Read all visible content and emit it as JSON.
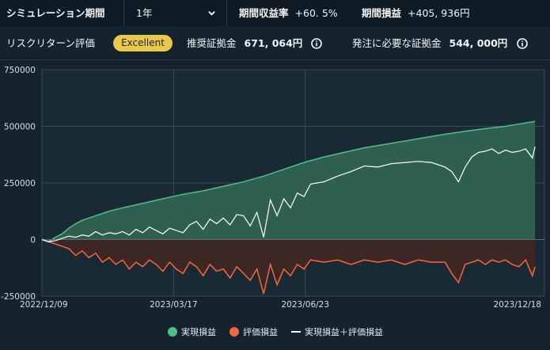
{
  "header": {
    "simulation_label": "シミュレーション期間",
    "period_value": "1年",
    "return_rate_label": "期間収益率",
    "return_rate_value": "+60. 5%",
    "pnl_label": "期間損益",
    "pnl_value": "+405, 936円"
  },
  "evaluation": {
    "label": "リスクリターン評価",
    "badge": "Excellent",
    "recommended_label": "推奨証拠金",
    "recommended_value": "671, 064円",
    "required_label": "発注に必要な証拠金",
    "required_value": "544, 000円"
  },
  "icons": {
    "period_dropdown": "chevron-down-icon",
    "info": "info-icon"
  },
  "colors": {
    "realized": "#4fbf86",
    "realized_fill": "#2f5f50",
    "unrealized": "#f4663d",
    "unrealized_fill": "#3d2724",
    "total": "#ffffff",
    "badge": "#e9c84a",
    "background": "#14232e"
  },
  "chart_data": {
    "type": "area",
    "y_ticks": [
      "750000",
      "500000",
      "250000",
      "0",
      "-250000"
    ],
    "ylim": [
      -250000,
      750000
    ],
    "x_ticks": [
      "2022/12/09",
      "2023/03/17",
      "2023/06/23",
      "2023/12/18"
    ],
    "x_tick_days": [
      0,
      98,
      196,
      374
    ],
    "xlim_days": [
      0,
      374
    ],
    "grid": true,
    "legend_position": "bottom",
    "series": [
      {
        "name": "実現損益",
        "x_days": [
          0,
          5,
          10,
          15,
          20,
          25,
          30,
          40,
          50,
          60,
          75,
          90,
          105,
          120,
          135,
          150,
          165,
          180,
          195,
          210,
          225,
          240,
          255,
          270,
          285,
          300,
          315,
          330,
          345,
          360,
          367
        ],
        "values": [
          0,
          -10000,
          10000,
          25000,
          50000,
          70000,
          85000,
          105000,
          125000,
          140000,
          160000,
          180000,
          200000,
          215000,
          235000,
          255000,
          280000,
          310000,
          340000,
          365000,
          385000,
          405000,
          420000,
          435000,
          450000,
          465000,
          478000,
          490000,
          500000,
          515000,
          522000
        ]
      },
      {
        "name": "評価損益",
        "x_days": [
          0,
          10,
          20,
          25,
          30,
          35,
          40,
          45,
          50,
          55,
          60,
          65,
          70,
          75,
          80,
          85,
          90,
          95,
          100,
          105,
          110,
          115,
          120,
          125,
          130,
          135,
          140,
          145,
          150,
          155,
          160,
          165,
          170,
          175,
          180,
          185,
          190,
          195,
          200,
          210,
          220,
          230,
          240,
          250,
          260,
          270,
          280,
          290,
          300,
          305,
          310,
          315,
          320,
          325,
          330,
          335,
          340,
          345,
          350,
          355,
          360,
          365,
          367
        ],
        "values": [
          0,
          -20000,
          -40000,
          -70000,
          -50000,
          -80000,
          -60000,
          -100000,
          -80000,
          -110000,
          -90000,
          -130000,
          -100000,
          -120000,
          -90000,
          -110000,
          -140000,
          -100000,
          -130000,
          -150000,
          -100000,
          -120000,
          -160000,
          -110000,
          -140000,
          -130000,
          -170000,
          -120000,
          -150000,
          -180000,
          -130000,
          -240000,
          -110000,
          -200000,
          -130000,
          -160000,
          -110000,
          -130000,
          -90000,
          -100000,
          -90000,
          -110000,
          -90000,
          -100000,
          -90000,
          -110000,
          -90000,
          -100000,
          -100000,
          -150000,
          -190000,
          -110000,
          -100000,
          -90000,
          -110000,
          -90000,
          -100000,
          -90000,
          -110000,
          -120000,
          -90000,
          -160000,
          -120000
        ]
      },
      {
        "name": "実現損益＋評価損益",
        "x_days": [
          0,
          5,
          10,
          15,
          20,
          25,
          30,
          35,
          40,
          45,
          50,
          55,
          60,
          65,
          70,
          75,
          80,
          85,
          90,
          95,
          100,
          105,
          110,
          115,
          120,
          125,
          130,
          135,
          140,
          145,
          150,
          155,
          160,
          165,
          170,
          175,
          180,
          185,
          190,
          195,
          200,
          210,
          220,
          230,
          240,
          250,
          260,
          270,
          280,
          290,
          300,
          305,
          310,
          315,
          320,
          325,
          330,
          335,
          340,
          345,
          350,
          355,
          360,
          365,
          367
        ],
        "values": [
          0,
          -10000,
          -5000,
          5000,
          15000,
          10000,
          20000,
          15000,
          35000,
          20000,
          30000,
          25000,
          35000,
          20000,
          45000,
          30000,
          55000,
          40000,
          25000,
          50000,
          40000,
          30000,
          65000,
          80000,
          45000,
          90000,
          70000,
          95000,
          65000,
          110000,
          105000,
          60000,
          120000,
          10000,
          175000,
          105000,
          180000,
          140000,
          205000,
          190000,
          245000,
          255000,
          280000,
          300000,
          325000,
          320000,
          335000,
          340000,
          345000,
          340000,
          320000,
          300000,
          255000,
          320000,
          365000,
          385000,
          390000,
          400000,
          380000,
          395000,
          385000,
          390000,
          400000,
          360000,
          410000
        ]
      }
    ]
  }
}
